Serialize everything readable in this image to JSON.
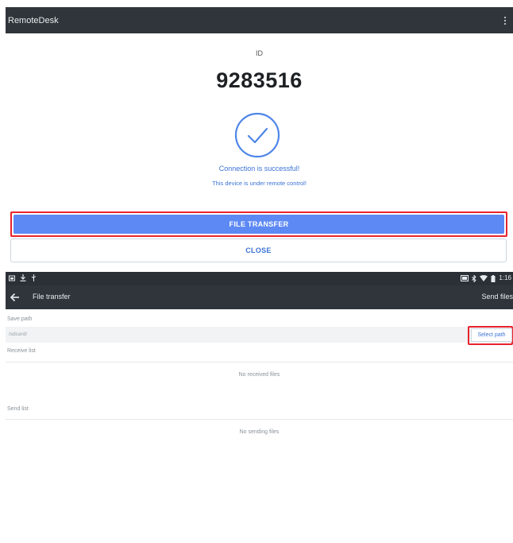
{
  "remote": {
    "app_title": "RemoteDesk",
    "id_label": "ID",
    "id_value": "9283516",
    "success_message": "Connection is successful!",
    "remote_message": "This device is under remote control!",
    "file_transfer_label": "FILE TRANSFER",
    "close_label": "CLOSE"
  },
  "status_bar": {
    "time": "1:16",
    "left_icons": [
      "screenshot-icon",
      "download-icon",
      "usb-icon"
    ],
    "right_icons": [
      "cast-icon",
      "bluetooth-icon",
      "wifi-icon",
      "battery-icon"
    ]
  },
  "file_transfer": {
    "title": "File transfer",
    "send_files_label": "Send files",
    "save_path_label": "Save path",
    "save_path_value": "/sdcard/",
    "select_path_label": "Select path",
    "receive_list_label": "Receive list",
    "no_received_text": "No received files",
    "send_list_label": "Send list",
    "no_sending_text": "No sending files"
  },
  "colors": {
    "accent": "#5d89f4",
    "link": "#3b73d6",
    "highlight": "#e8242c",
    "appbar": "#2f353a"
  }
}
